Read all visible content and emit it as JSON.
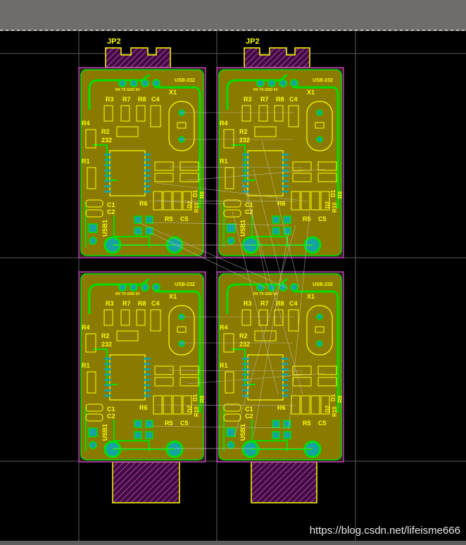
{
  "header": {
    "jp_label": "JP2"
  },
  "board": {
    "title": "USB-232",
    "pin_text": "RX TX GND 5V",
    "labels": {
      "r3": "R3",
      "r7": "R7",
      "r8": "R8",
      "c4": "C4",
      "x1": "X1",
      "r4": "R4",
      "r2": "R2",
      "ic": "232",
      "r1": "R1",
      "c1": "C1",
      "c2": "C2",
      "r6": "R6",
      "r5": "R5",
      "c5": "C5",
      "usb": "USB1",
      "d2": "D2",
      "d1": "D1",
      "r10": "R10",
      "r9": "R9"
    }
  },
  "watermark": "https://blog.csdn.net/lifeisme666",
  "colors": {
    "background": "#000000",
    "board_fill": "#8a7a00",
    "copper_trace": "#00e000",
    "silkscreen": "#ffff00",
    "keepout": "#e040e0"
  }
}
